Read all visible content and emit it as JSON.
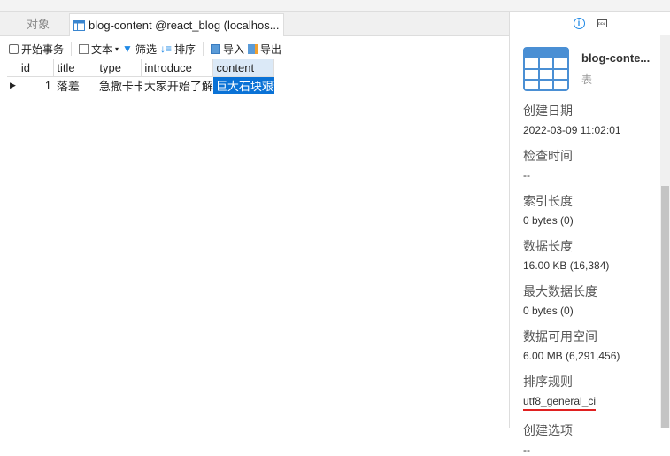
{
  "tabs": {
    "objects": "对象",
    "active": "blog-content @react_blog (localhos..."
  },
  "toolbar": {
    "begin": "开始事务",
    "text": "文本",
    "filter": "筛选",
    "sort": "排序",
    "import": "导入",
    "export": "导出"
  },
  "table": {
    "columns": [
      "id",
      "title",
      "type",
      "introduce",
      "content"
    ],
    "rows": [
      [
        "1",
        "落差",
        "急撒卡卡",
        "大家开始了解卡",
        "巨大石块艰苦"
      ]
    ]
  },
  "info": {
    "name": "blog-conte...",
    "kind": "表",
    "props": [
      {
        "label": "创建日期",
        "value": "2022-03-09 11:02:01"
      },
      {
        "label": "检查时间",
        "value": "--"
      },
      {
        "label": "索引长度",
        "value": "0 bytes (0)"
      },
      {
        "label": "数据长度",
        "value": "16.00 KB (16,384)"
      },
      {
        "label": "最大数据长度",
        "value": "0 bytes (0)"
      },
      {
        "label": "数据可用空间",
        "value": "6.00 MB (6,291,456)"
      },
      {
        "label": "排序规则",
        "value": "utf8_general_ci"
      },
      {
        "label": "创建选项",
        "value": "--"
      }
    ]
  }
}
